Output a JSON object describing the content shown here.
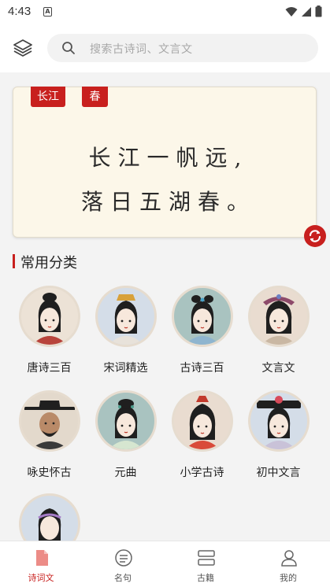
{
  "status_bar": {
    "time": "4:43",
    "a_badge": "A"
  },
  "search": {
    "placeholder": "搜索古诗词、文言文"
  },
  "poem": {
    "tags": [
      "长江",
      "春"
    ],
    "lines": [
      "长江一帆远,",
      "落日五湖春。"
    ]
  },
  "section": {
    "title": "常用分类"
  },
  "categories": [
    {
      "label": "唐诗三百",
      "icon": "tang-poet-avatar-icon"
    },
    {
      "label": "宋词精选",
      "icon": "song-lady-avatar-icon"
    },
    {
      "label": "古诗三百",
      "icon": "ancient-lady-avatar-icon"
    },
    {
      "label": "文言文",
      "icon": "scholar-lady-avatar-icon"
    },
    {
      "label": "咏史怀古",
      "icon": "official-avatar-icon"
    },
    {
      "label": "元曲",
      "icon": "opera-lady-avatar-icon"
    },
    {
      "label": "小学古诗",
      "icon": "princess-avatar-icon"
    },
    {
      "label": "初中文言",
      "icon": "qing-lady-avatar-icon"
    },
    {
      "label": "",
      "icon": "girl-avatar-icon"
    }
  ],
  "bottom_nav": [
    {
      "label": "诗词文",
      "icon": "document-icon",
      "active": true
    },
    {
      "label": "名句",
      "icon": "quote-icon",
      "active": false
    },
    {
      "label": "古籍",
      "icon": "books-icon",
      "active": false
    },
    {
      "label": "我的",
      "icon": "person-icon",
      "active": false
    }
  ],
  "colors": {
    "accent": "#c8201e",
    "card_bg": "#fcf7e9",
    "page_bg": "#f3f3f3"
  }
}
